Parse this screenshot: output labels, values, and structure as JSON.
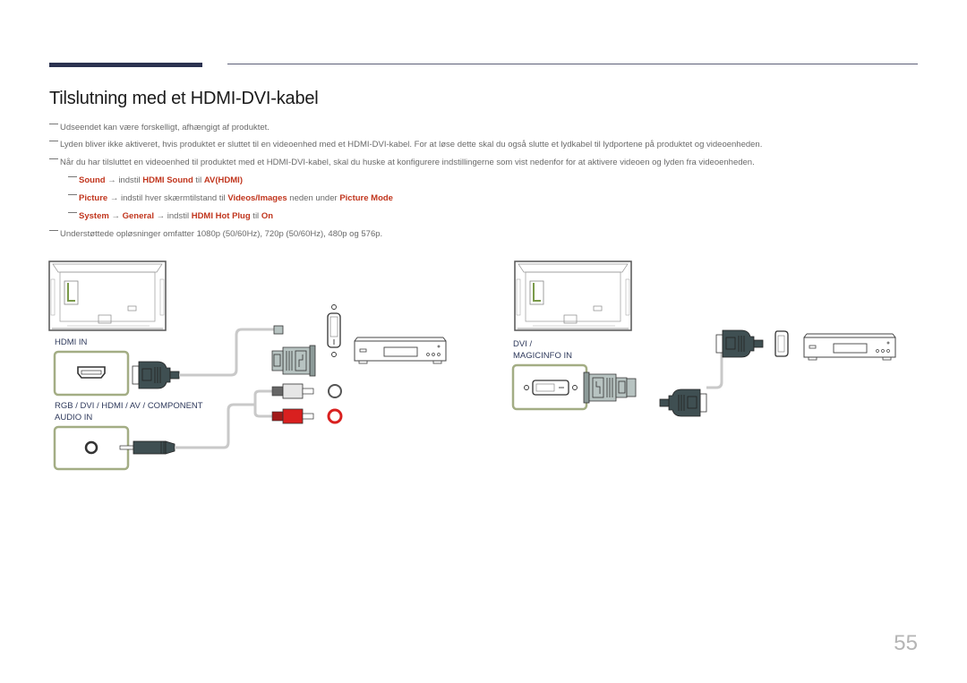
{
  "header": {
    "title": "Tilslutning med et HDMI-DVI-kabel"
  },
  "notes": [
    "Udseendet kan være forskelligt, afhængigt af produktet.",
    "Lyden bliver ikke aktiveret, hvis produktet er sluttet til en videoenhed med et HDMI-DVI-kabel. For at løse dette skal du også slutte et lydkabel til lydportene på produktet og videoenheden.",
    "Når du har tilsluttet en videoenhed til produktet med et HDMI-DVI-kabel, skal du huske at konfigurere indstillingerne som vist nedenfor for at aktivere videoen og lyden fra videoenheden."
  ],
  "subnotes": [
    {
      "parts": [
        {
          "text": "Sound",
          "hl": true
        },
        {
          "text": " → indstil ",
          "hl": false
        },
        {
          "text": "HDMI Sound",
          "hl": true
        },
        {
          "text": " til ",
          "hl": false
        },
        {
          "text": "AV(HDMI)",
          "hl": true
        }
      ]
    },
    {
      "parts": [
        {
          "text": "Picture",
          "hl": true
        },
        {
          "text": " → indstil hver skærmtilstand til ",
          "hl": false
        },
        {
          "text": "Videos/Images",
          "hl": true
        },
        {
          "text": " neden under ",
          "hl": false
        },
        {
          "text": "Picture Mode",
          "hl": true
        }
      ]
    },
    {
      "parts": [
        {
          "text": "System",
          "hl": true
        },
        {
          "text": " → ",
          "hl": false
        },
        {
          "text": "General",
          "hl": true
        },
        {
          "text": " → indstil ",
          "hl": false
        },
        {
          "text": "HDMI Hot Plug",
          "hl": true
        },
        {
          "text": " til ",
          "hl": false
        },
        {
          "text": "On",
          "hl": true
        }
      ]
    }
  ],
  "note_last": "Understøttede opløsninger omfatter 1080p (50/60Hz), 720p (50/60Hz), 480p og 576p.",
  "diagram_left": {
    "hdmi_label": "HDMI IN",
    "audio_label_line1": "RGB / DVI / HDMI / AV / COMPONENT",
    "audio_label_line2": "AUDIO IN"
  },
  "diagram_right": {
    "dvi_label_line1": "DVI /",
    "dvi_label_line2": "MAGICINFO IN"
  },
  "colors": {
    "accent_red": "#c1361e",
    "label_navy": "#2f3a5c",
    "port_frame_green": "#a3ad84",
    "connector_dark": "#3f4f52",
    "rca_red": "#d9201f"
  },
  "footer": {
    "page_number": "55"
  }
}
